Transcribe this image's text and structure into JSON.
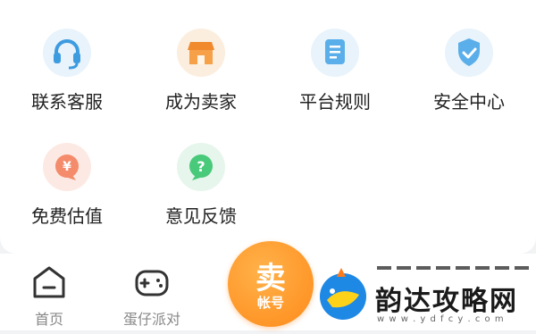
{
  "services": [
    {
      "label": "联系客服",
      "icon": "headset-icon"
    },
    {
      "label": "成为卖家",
      "icon": "store-icon"
    },
    {
      "label": "平台规则",
      "icon": "document-icon"
    },
    {
      "label": "安全中心",
      "icon": "shield-check-icon"
    },
    {
      "label": "免费估值",
      "icon": "yuan-bubble-icon"
    },
    {
      "label": "意见反馈",
      "icon": "question-bubble-icon"
    }
  ],
  "tabbar": {
    "home": {
      "label": "首页",
      "icon": "home-icon"
    },
    "party": {
      "label": "蛋仔派对",
      "icon": "gamepad-icon"
    },
    "sell": {
      "line1": "卖",
      "line2": "帐号"
    }
  },
  "watermark": {
    "text": "韵达攻略网",
    "url": "w w w . y d f c y . c o m"
  },
  "colors": {
    "accent_orange": "#ff8a1a",
    "icon_blue": "#4aa6e8",
    "green": "#3cc46a"
  }
}
